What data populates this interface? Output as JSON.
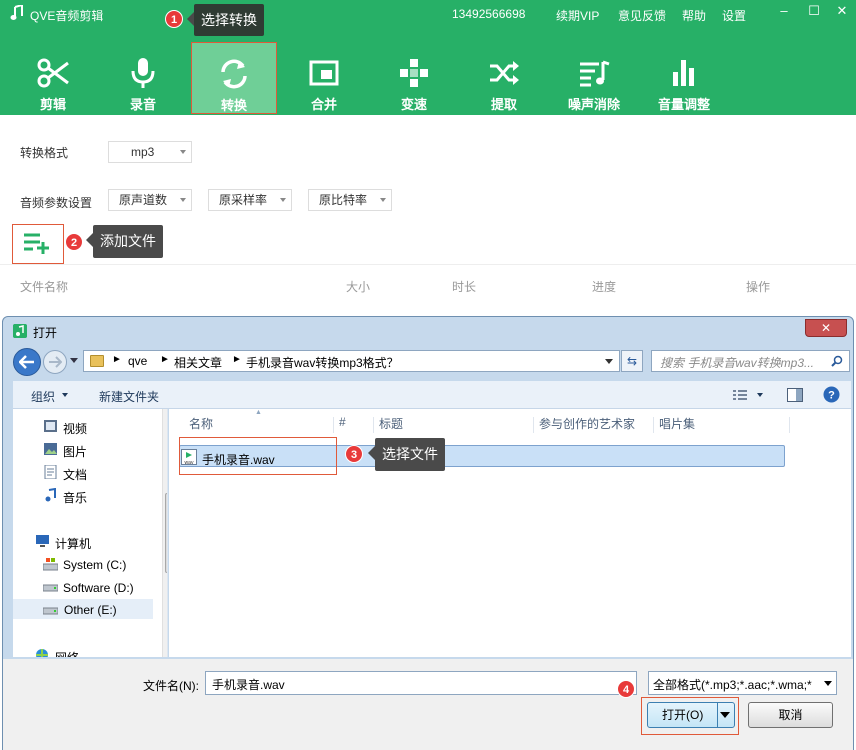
{
  "app": {
    "title": "QVE音频剪辑",
    "phone": "13492566698",
    "links": [
      "续期VIP",
      "意见反馈",
      "帮助",
      "设置"
    ],
    "window_controls": [
      "–",
      "☐",
      "✕"
    ]
  },
  "toolbar": {
    "items": [
      {
        "label": "剪辑",
        "icon": "scissors-icon"
      },
      {
        "label": "录音",
        "icon": "microphone-icon"
      },
      {
        "label": "转换",
        "icon": "convert-icon",
        "active": true
      },
      {
        "label": "合并",
        "icon": "merge-icon"
      },
      {
        "label": "变速",
        "icon": "speed-icon"
      },
      {
        "label": "提取",
        "icon": "shuffle-icon"
      },
      {
        "label": "噪声消除",
        "icon": "noise-icon"
      },
      {
        "label": "音量调整",
        "icon": "volume-bars-icon"
      }
    ]
  },
  "callouts": [
    {
      "num": "1",
      "text": "选择转换"
    },
    {
      "num": "2",
      "text": "添加文件"
    },
    {
      "num": "3",
      "text": "选择文件"
    },
    {
      "num": "4"
    }
  ],
  "settings": {
    "format_label": "转换格式",
    "format_value": "mp3",
    "params_label": "音频参数设置",
    "channels_value": "原声道数",
    "samplerate_value": "原采样率",
    "bitrate_value": "原比特率"
  },
  "file_table": {
    "headers": [
      "文件名称",
      "大小",
      "时长",
      "进度",
      "操作"
    ]
  },
  "dialog": {
    "title": "打开",
    "close": "✕",
    "path": [
      "qve",
      "相关文章",
      "手机录音wav转换mp3格式？"
    ],
    "search_placeholder": "搜索 手机录音wav转换mp3...",
    "organize": "组织",
    "new_folder": "新建文件夹",
    "tree": [
      {
        "label": "视频",
        "icon": "video-folder-icon"
      },
      {
        "label": "图片",
        "icon": "picture-folder-icon"
      },
      {
        "label": "文档",
        "icon": "document-folder-icon"
      },
      {
        "label": "音乐",
        "icon": "music-folder-icon"
      },
      {
        "label": "计算机",
        "icon": "computer-icon"
      },
      {
        "label": "System (C:)",
        "icon": "system-drive-icon"
      },
      {
        "label": "Software (D:)",
        "icon": "drive-icon"
      },
      {
        "label": "Other (E:)",
        "icon": "drive-icon",
        "selected": true
      },
      {
        "label": "网络",
        "icon": "network-icon"
      }
    ],
    "columns": [
      "名称",
      "#",
      "标题",
      "参与创作的艺术家",
      "唱片集"
    ],
    "files": [
      {
        "name": "手机录音.wav"
      }
    ],
    "filename_label": "文件名(N):",
    "filename_value": "手机录音.wav",
    "filetype_value": "全部格式(*.mp3;*.aac;*.wma;*",
    "open_button": "打开(O)",
    "cancel_button": "取消"
  }
}
